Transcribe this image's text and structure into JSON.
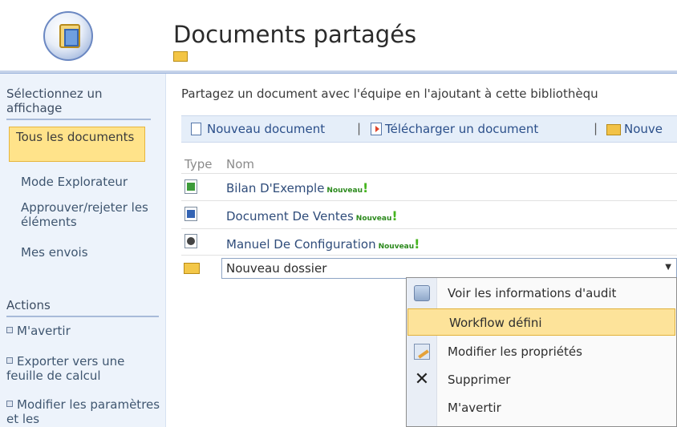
{
  "header": {
    "title": "Documents partagés"
  },
  "leftnav": {
    "view_heading": "Sélectionnez un affichage",
    "views": [
      {
        "label": "Tous les documents",
        "selected": true
      },
      {
        "label": "Mode Explorateur"
      },
      {
        "label": "Approuver/rejeter les éléments"
      },
      {
        "label": "Mes envois"
      }
    ],
    "actions_heading": "Actions",
    "actions": [
      {
        "label": "M'avertir"
      },
      {
        "label": "Exporter vers une feuille de calcul"
      },
      {
        "label": "Modifier les paramètres et les"
      }
    ]
  },
  "main": {
    "description": "Partagez un document avec l'équipe en l'ajoutant à cette bibliothèqu",
    "toolbar": {
      "new_document": "Nouveau document",
      "upload_document": "Télécharger un document",
      "new_folder": "Nouve",
      "separator": "|"
    },
    "columns": {
      "type": "Type",
      "name": "Nom"
    },
    "rows": [
      {
        "name": "Bilan D'Exemple",
        "new_label": "Nouveau",
        "icon": "excel-file-icon"
      },
      {
        "name": "Document De Ventes",
        "new_label": "Nouveau",
        "icon": "word-file-icon"
      },
      {
        "name": "Manuel De Configuration",
        "new_label": "Nouveau",
        "icon": "generic-file-icon"
      }
    ],
    "folder": {
      "name": "Nouveau dossier",
      "arrow": "▼"
    },
    "new_mark": "!"
  },
  "context_menu": {
    "items": [
      {
        "label": "Voir les informations d'audit",
        "icon": "audit-icon"
      },
      {
        "label": "Workflow défini",
        "highlighted": true
      },
      {
        "label": "Modifier les propriétés",
        "icon": "edit-properties-icon"
      },
      {
        "label": "Supprimer",
        "icon": "delete-icon",
        "glyph": "✕"
      },
      {
        "label": "M'avertir"
      }
    ]
  },
  "colors": {
    "nav_bg": "#edf3fb",
    "selected_bg": "#ffe38a",
    "link": "#2f4c7a",
    "new_green": "#2c8a1d",
    "menu_highlight": "#fde39a"
  }
}
